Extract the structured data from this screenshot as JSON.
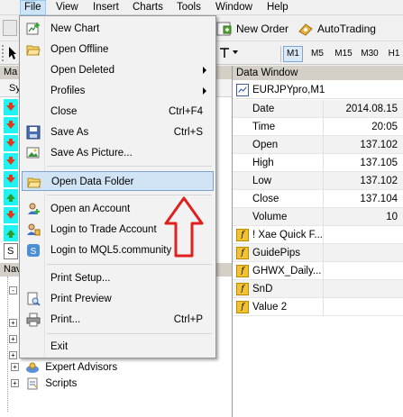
{
  "menubar": {
    "items": [
      "File",
      "View",
      "Insert",
      "Charts",
      "Tools",
      "Window",
      "Help"
    ]
  },
  "toolbar": {
    "new_order": "New Order",
    "autotrading": "AutoTrading",
    "timeframes": [
      "M1",
      "M5",
      "M15",
      "M30",
      "H1"
    ]
  },
  "market_watch": {
    "title": "Ma",
    "column": "Sy",
    "row_letter": "S"
  },
  "navigator": {
    "title": "Nav",
    "items": [
      "Expert Advisors",
      "Scripts"
    ]
  },
  "data_window": {
    "title": "Data Window",
    "symbol": "EURJPYpro,M1",
    "rows": [
      {
        "k": "Date",
        "v": "2014.08.15"
      },
      {
        "k": "Time",
        "v": "20:05"
      },
      {
        "k": "Open",
        "v": "137.102"
      },
      {
        "k": "High",
        "v": "137.105"
      },
      {
        "k": "Low",
        "v": "137.102"
      },
      {
        "k": "Close",
        "v": "137.104"
      },
      {
        "k": "Volume",
        "v": "10"
      }
    ],
    "indicators": [
      "! Xae Quick F...",
      "GuidePips",
      "GHWX_Daily...",
      "SnD",
      "Value 2"
    ]
  },
  "file_menu": {
    "items": [
      {
        "label": "New Chart",
        "shortcut": "",
        "icon": "new-chart-icon"
      },
      {
        "label": "Open Offline",
        "shortcut": "",
        "icon": "open-folder-icon"
      },
      {
        "label": "Open Deleted",
        "shortcut": "",
        "submenu": true
      },
      {
        "label": "Profiles",
        "shortcut": "",
        "submenu": true
      },
      {
        "label": "Close",
        "shortcut": "Ctrl+F4"
      },
      {
        "label": "Save As",
        "shortcut": "Ctrl+S",
        "icon": "save-icon"
      },
      {
        "label": "Save As Picture...",
        "shortcut": "",
        "icon": "picture-icon"
      },
      {
        "label": "Open Data Folder",
        "shortcut": "",
        "icon": "data-folder-icon"
      },
      {
        "label": "Open an Account",
        "shortcut": "",
        "icon": "account-icon"
      },
      {
        "label": "Login to Trade Account",
        "shortcut": "",
        "icon": "login-icon"
      },
      {
        "label": "Login to MQL5.community",
        "shortcut": "",
        "icon": "mql5-icon"
      },
      {
        "label": "Print Setup...",
        "shortcut": ""
      },
      {
        "label": "Print Preview",
        "shortcut": "",
        "icon": "print-preview-icon"
      },
      {
        "label": "Print...",
        "shortcut": "Ctrl+P",
        "icon": "printer-icon"
      },
      {
        "label": "Exit",
        "shortcut": ""
      }
    ]
  },
  "colors": {
    "highlight": "#d1e4f5",
    "annotation": "#e0201e",
    "market_watch_row": "#21f2f2"
  }
}
